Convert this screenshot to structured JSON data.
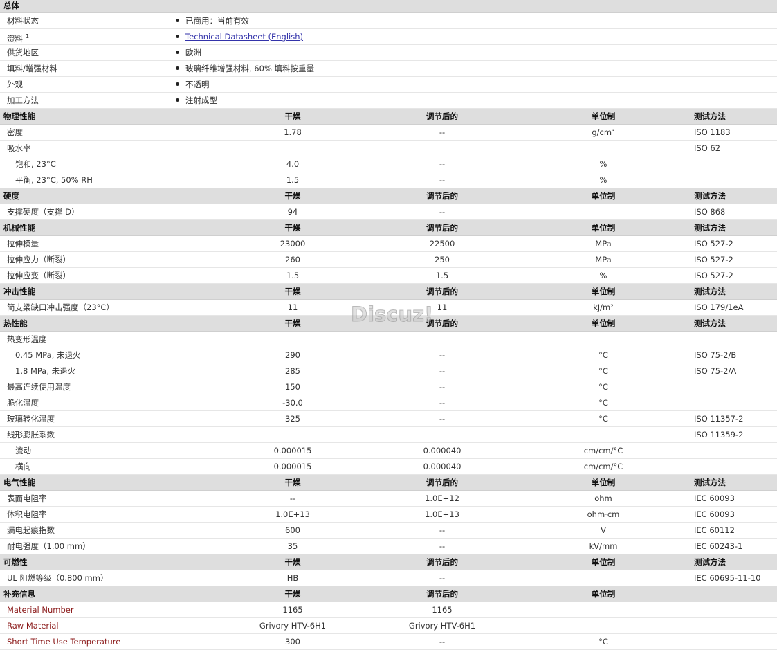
{
  "general": {
    "title": "总体",
    "rows": [
      {
        "label": "材料状态",
        "value": "已商用：当前有效"
      },
      {
        "label": "资料",
        "sup": "1",
        "value": "Technical Datasheet (English)",
        "link": true
      },
      {
        "label": "供货地区",
        "value": "欧洲"
      },
      {
        "label": "填料/增强材料",
        "value": "玻璃纤维增强材料, 60% 填料按重量"
      },
      {
        "label": "外观",
        "value": "不透明"
      },
      {
        "label": "加工方法",
        "value": "注射成型"
      }
    ]
  },
  "col_headers": {
    "dry": "干燥",
    "cond": "调节后的",
    "unit": "单位制",
    "test": "测试方法"
  },
  "sections": [
    {
      "title": "物理性能",
      "show_test": true,
      "rows": [
        {
          "label": "密度",
          "dry": "1.78",
          "cond": "--",
          "unit": "g/cm³",
          "test": "ISO 1183"
        },
        {
          "label": "吸水率",
          "dry": "",
          "cond": "",
          "unit": "",
          "test": "ISO 62"
        },
        {
          "label": "饱和, 23°C",
          "sub": true,
          "dry": "4.0",
          "cond": "--",
          "unit": "%",
          "test": ""
        },
        {
          "label": "平衡, 23°C, 50% RH",
          "sub": true,
          "dry": "1.5",
          "cond": "--",
          "unit": "%",
          "test": ""
        }
      ]
    },
    {
      "title": "硬度",
      "show_test": true,
      "rows": [
        {
          "label": "支撑硬度（支撑 D）",
          "dry": "94",
          "cond": "--",
          "unit": "",
          "test": "ISO 868"
        }
      ]
    },
    {
      "title": "机械性能",
      "show_test": true,
      "rows": [
        {
          "label": "拉伸模量",
          "dry": "23000",
          "cond": "22500",
          "unit": "MPa",
          "test": "ISO 527-2"
        },
        {
          "label": "拉伸应力（断裂）",
          "dry": "260",
          "cond": "250",
          "unit": "MPa",
          "test": "ISO 527-2"
        },
        {
          "label": "拉伸应变（断裂）",
          "dry": "1.5",
          "cond": "1.5",
          "unit": "%",
          "test": "ISO 527-2"
        }
      ]
    },
    {
      "title": "冲击性能",
      "show_test": true,
      "rows": [
        {
          "label": "简支梁缺口冲击强度（23°C）",
          "dry": "11",
          "cond": "11",
          "unit": "kJ/m²",
          "test": "ISO 179/1eA"
        }
      ]
    },
    {
      "title": "热性能",
      "show_test": true,
      "rows": [
        {
          "label": "热变形温度",
          "dry": "",
          "cond": "",
          "unit": "",
          "test": ""
        },
        {
          "label": "0.45 MPa, 未退火",
          "sub": true,
          "dry": "290",
          "cond": "--",
          "unit": "°C",
          "test": "ISO 75-2/B"
        },
        {
          "label": "1.8 MPa, 未退火",
          "sub": true,
          "dry": "285",
          "cond": "--",
          "unit": "°C",
          "test": "ISO 75-2/A"
        },
        {
          "label": "最高连续使用温度",
          "dry": "150",
          "cond": "--",
          "unit": "°C",
          "test": ""
        },
        {
          "label": "脆化温度",
          "dry": "-30.0",
          "cond": "--",
          "unit": "°C",
          "test": ""
        },
        {
          "label": "玻璃转化温度",
          "dry": "325",
          "cond": "--",
          "unit": "°C",
          "test": "ISO 11357-2"
        },
        {
          "label": "线形膨胀系数",
          "dry": "",
          "cond": "",
          "unit": "",
          "test": "ISO 11359-2"
        },
        {
          "label": "流动",
          "sub": true,
          "dry": "0.000015",
          "cond": "0.000040",
          "unit": "cm/cm/°C",
          "test": ""
        },
        {
          "label": "横向",
          "sub": true,
          "dry": "0.000015",
          "cond": "0.000040",
          "unit": "cm/cm/°C",
          "test": ""
        }
      ]
    },
    {
      "title": "电气性能",
      "show_test": true,
      "rows": [
        {
          "label": "表面电阻率",
          "dry": "--",
          "cond": "1.0E+12",
          "unit": "ohm",
          "test": "IEC 60093"
        },
        {
          "label": "体积电阻率",
          "dry": "1.0E+13",
          "cond": "1.0E+13",
          "unit": "ohm·cm",
          "test": "IEC 60093"
        },
        {
          "label": "漏电起痕指数",
          "dry": "600",
          "cond": "--",
          "unit": "V",
          "test": "IEC 60112"
        },
        {
          "label": "耐电强度（1.00 mm）",
          "dry": "35",
          "cond": "--",
          "unit": "kV/mm",
          "test": "IEC 60243-1"
        }
      ]
    },
    {
      "title": "可燃性",
      "show_test": true,
      "rows": [
        {
          "label": "UL 阻燃等级（0.800 mm）",
          "dry": "HB",
          "cond": "--",
          "unit": "",
          "test": "IEC 60695-11-10"
        }
      ]
    },
    {
      "title": "补充信息",
      "show_test": false,
      "rows": [
        {
          "label": "Material Number",
          "red": true,
          "dry": "1165",
          "cond": "1165",
          "unit": "",
          "test": ""
        },
        {
          "label": "Raw Material",
          "red": true,
          "dry": "Grivory HTV-6H1",
          "cond": "Grivory HTV-6H1",
          "unit": "",
          "test": ""
        },
        {
          "label": "Short Time Use Temperature",
          "red": true,
          "dry": "300",
          "cond": "--",
          "unit": "°C",
          "test": ""
        }
      ]
    }
  ],
  "watermark": "Discuz!"
}
